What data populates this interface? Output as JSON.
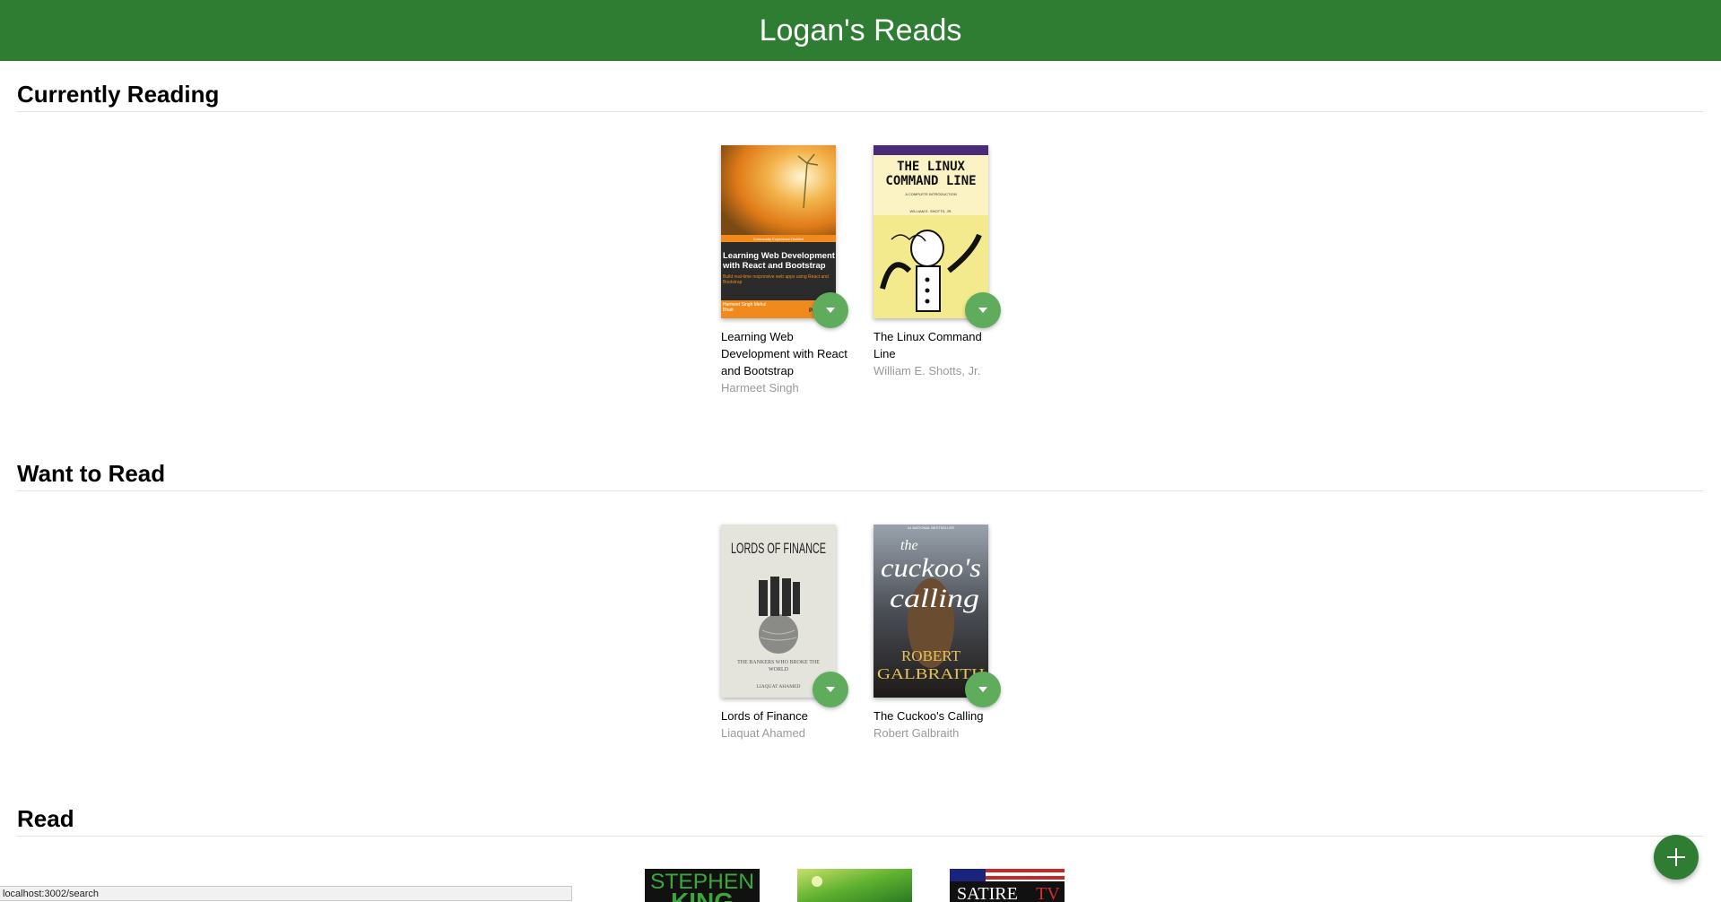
{
  "header": {
    "title": "Logan's Reads"
  },
  "shelves": {
    "currently_reading": {
      "title": "Currently Reading",
      "books": [
        {
          "title": "Learning Web Development with React and Bootstrap",
          "author": "Harmeet Singh",
          "cover": {
            "series": "Community Experience Distilled",
            "heading": "Learning Web Development with React and Bootstrap",
            "subtitle": "Build real-time responsive web apps using React and Bootstrap",
            "authors": "Harmeet Singh  Mehul Bhatt",
            "publisher": "PACKT"
          }
        },
        {
          "title": "The Linux Command Line",
          "author": "William E. Shotts, Jr.",
          "cover": {
            "heading": "THE LINUX COMMAND LINE",
            "subtitle": "A COMPLETE INTRODUCTION",
            "authors": "WILLIAM E. SHOTTS, JR."
          }
        }
      ]
    },
    "want_to_read": {
      "title": "Want to Read",
      "books": [
        {
          "title": "Lords of Finance",
          "author": "Liaquat Ahamed",
          "cover": {
            "heading": "LORDS OF FINANCE",
            "subtitle": "THE BANKERS WHO BROKE THE WORLD",
            "authors": "LIAQUAT AHAMED"
          }
        },
        {
          "title": "The Cuckoo's Calling",
          "author": "Robert Galbraith",
          "cover": {
            "badge": "#1 NATIONAL BESTSELLER",
            "heading_line1": "the",
            "heading_line2": "cuckoo's",
            "heading_line3": "calling",
            "authors_line1": "ROBERT",
            "authors_line2": "GALBRAITH"
          }
        }
      ]
    },
    "read": {
      "title": "Read",
      "covers": [
        {
          "text_line1": "STEPHEN",
          "text_line2": "KING"
        },
        {
          "text": ""
        },
        {
          "text_line1": "SATIRE",
          "text_line2": "TV"
        }
      ]
    }
  },
  "fab": {
    "label": "Add a book",
    "icon": "plus-icon"
  },
  "status_bar": {
    "url": "localhost:3002/search"
  },
  "colors": {
    "header": "#2e7d32",
    "shelf_changer": "#60ac5d",
    "author": "#999999"
  }
}
